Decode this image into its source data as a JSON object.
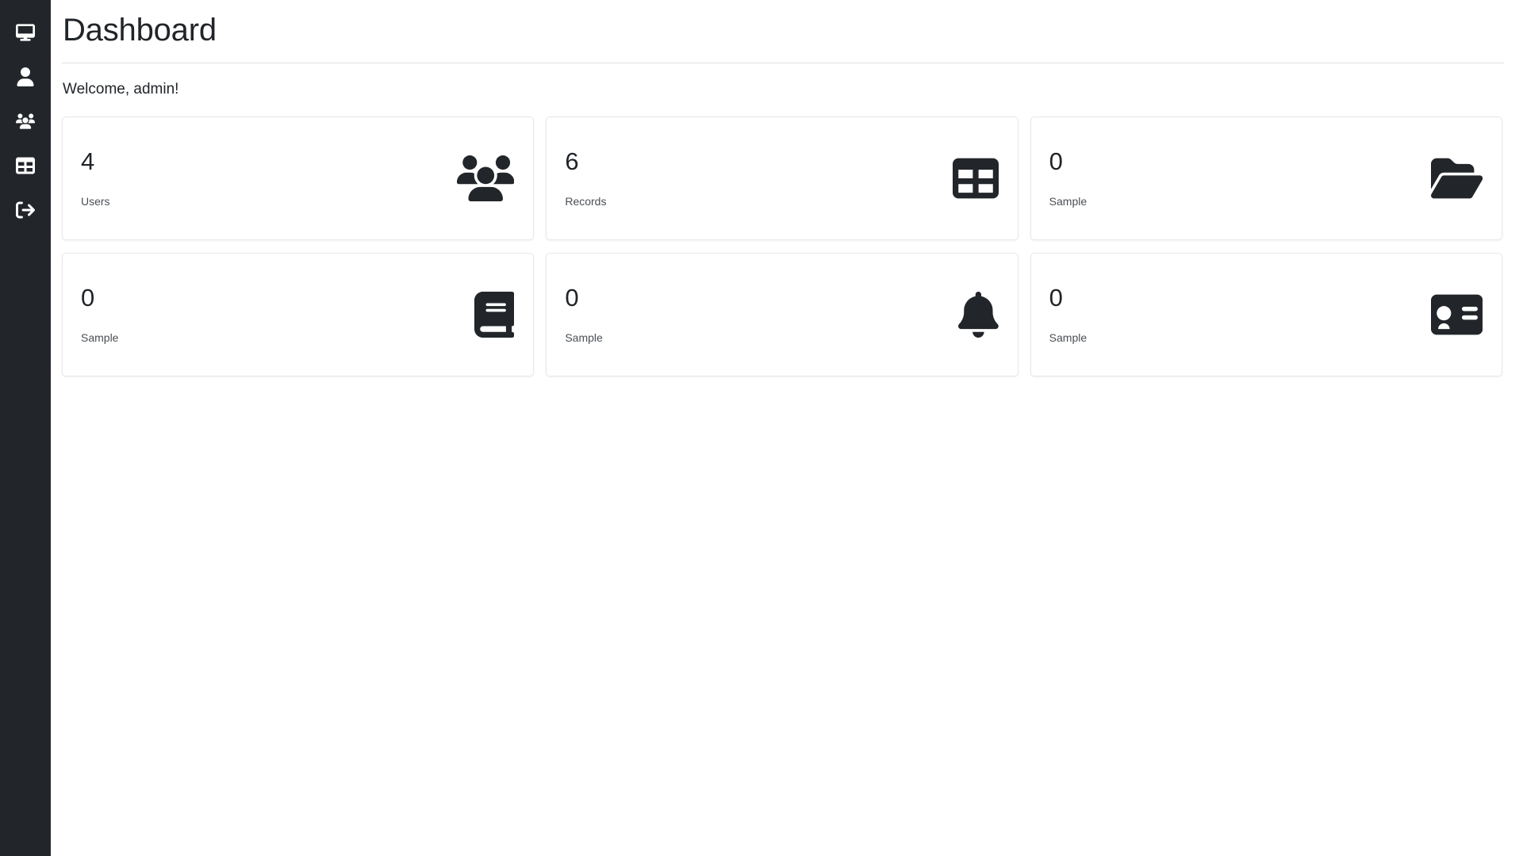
{
  "sidebar": {
    "items": [
      {
        "name": "dashboard",
        "icon": "desktop-icon",
        "label": "Dashboard"
      },
      {
        "name": "profile",
        "icon": "user-icon",
        "label": "Profile"
      },
      {
        "name": "users",
        "icon": "users-icon",
        "label": "Users"
      },
      {
        "name": "records",
        "icon": "table-list-icon",
        "label": "Records"
      },
      {
        "name": "logout",
        "icon": "sign-out-icon",
        "label": "Logout"
      }
    ]
  },
  "header": {
    "title": "Dashboard"
  },
  "main": {
    "welcome": "Welcome, admin!",
    "cards": [
      {
        "value": "4",
        "label": "Users",
        "icon": "users-icon"
      },
      {
        "value": "6",
        "label": "Records",
        "icon": "table-icon"
      },
      {
        "value": "0",
        "label": "Sample",
        "icon": "folder-open-icon"
      },
      {
        "value": "0",
        "label": "Sample",
        "icon": "book-icon"
      },
      {
        "value": "0",
        "label": "Sample",
        "icon": "bell-icon"
      },
      {
        "value": "0",
        "label": "Sample",
        "icon": "id-card-icon"
      }
    ]
  },
  "colors": {
    "sidebar_bg": "#22262b",
    "page_bg": "#ffffff",
    "text": "#212529",
    "card_border": "#e6e8ea",
    "icon": "#22262b"
  }
}
